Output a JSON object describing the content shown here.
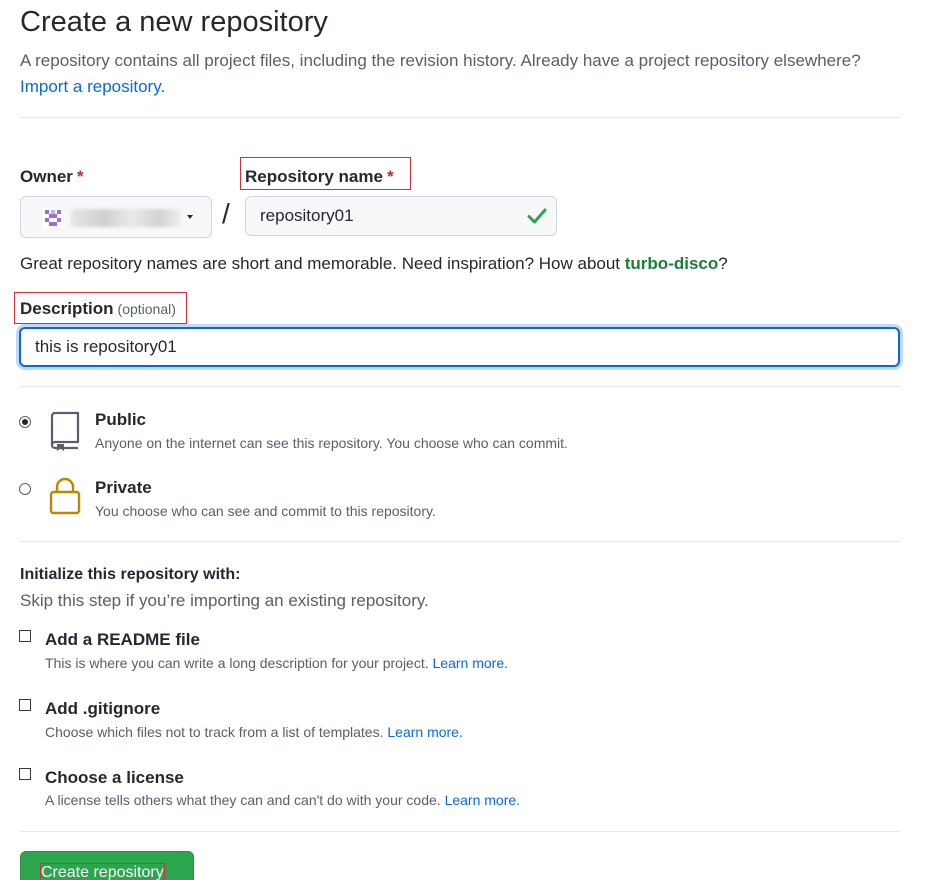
{
  "header": {
    "title": "Create a new repository",
    "intro_text": "A repository contains all project files, including the revision history. Already have a project repository elsewhere?",
    "import_link": "Import a repository."
  },
  "owner": {
    "label": "Owner",
    "required_mark": "*",
    "avatar_icon": "identicon-avatar"
  },
  "repo_name": {
    "label": "Repository name",
    "required_mark": "*",
    "value": "repository01",
    "valid_icon": "check-icon"
  },
  "hint": {
    "text": "Great repository names are short and memorable. Need inspiration? How about",
    "suggestion": "turbo-disco",
    "suffix": "?"
  },
  "description": {
    "label": "Description",
    "optional": "(optional)",
    "value": "this is repository01"
  },
  "visibility": {
    "public": {
      "title": "Public",
      "desc": "Anyone on the internet can see this repository. You choose who can commit.",
      "icon": "repo-icon",
      "selected": true
    },
    "private": {
      "title": "Private",
      "desc": "You choose who can see and commit to this repository.",
      "icon": "lock-icon",
      "selected": false
    }
  },
  "init": {
    "title": "Initialize this repository with:",
    "subtitle": "Skip this step if you’re importing an existing repository.",
    "options": [
      {
        "title": "Add a README file",
        "desc": "This is where you can write a long description for your project.",
        "link": "Learn more.",
        "checked": false
      },
      {
        "title": "Add .gitignore",
        "desc": "Choose which files not to track from a list of templates.",
        "link": "Learn more.",
        "checked": false
      },
      {
        "title": "Choose a license",
        "desc": "A license tells others what they can and can't do with your code.",
        "link": "Learn more.",
        "checked": false
      }
    ]
  },
  "submit": {
    "label": "Create repository"
  },
  "colors": {
    "accent_blue": "#0969da",
    "success_green": "#2da44e",
    "suggestion_green": "#1a7f37",
    "required_red": "#cf222e",
    "highlight_box_red": "#d0303a",
    "lock_gold": "#bf8700"
  }
}
